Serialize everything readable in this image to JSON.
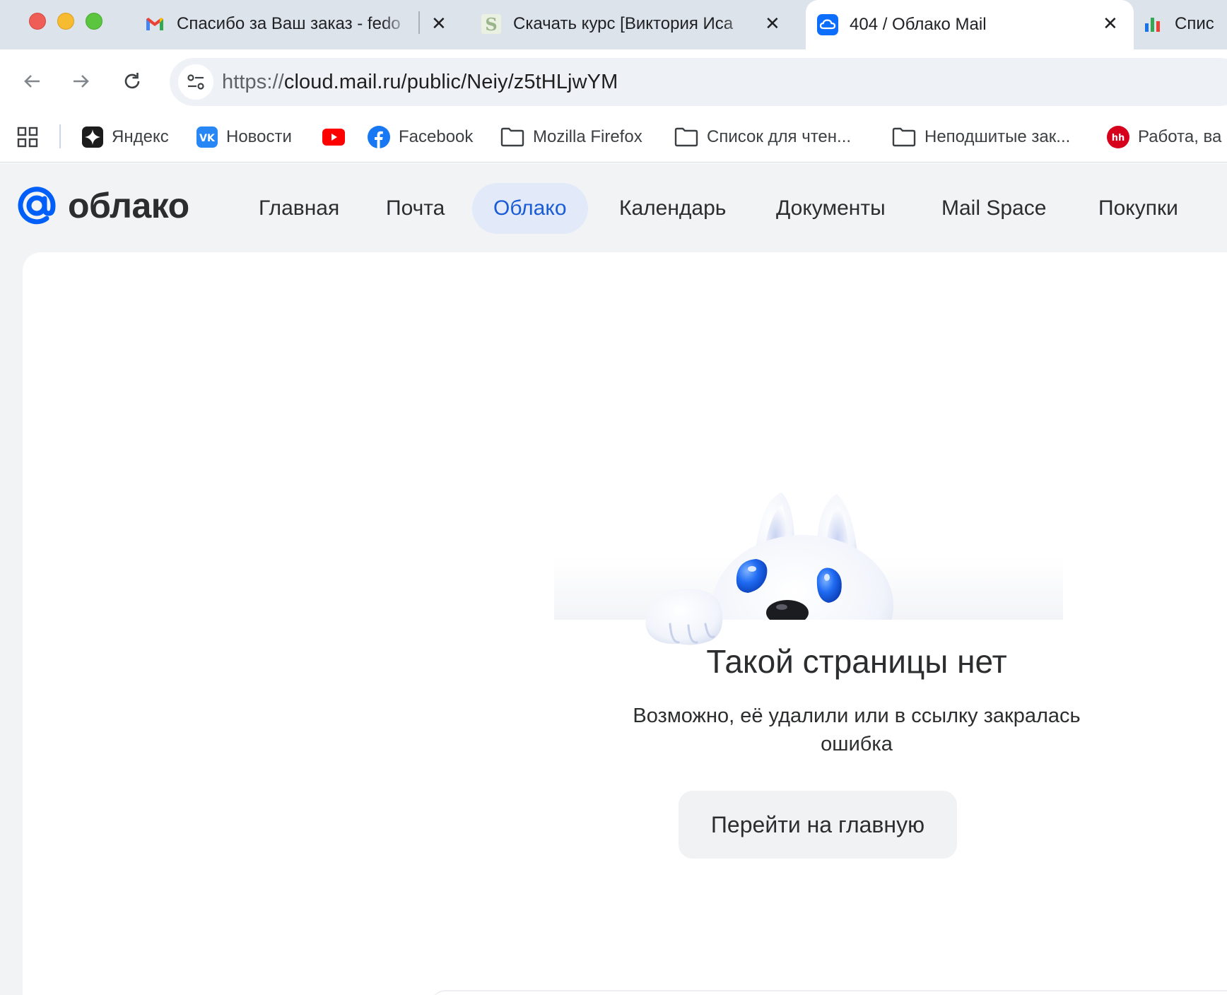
{
  "browser": {
    "tabs": [
      {
        "title": "Спасибо за Ваш заказ - fedo",
        "icon": "gmail-icon"
      },
      {
        "title": "Скачать курс [Виктория Иса",
        "icon": "s-logo-icon"
      },
      {
        "title": "404 / Облако Mail",
        "icon": "cloud-icon",
        "active": true
      },
      {
        "title": "Спис",
        "icon": "chart-bars-icon"
      }
    ],
    "close_glyph": "✕",
    "url": {
      "scheme": "https://",
      "rest": "cloud.mail.ru/public/Neiy/z5tHLjwYM"
    },
    "bookmarks": [
      {
        "label": "Яндекс",
        "icon": "yandex-icon"
      },
      {
        "label": "Новости",
        "icon": "vk-icon"
      },
      {
        "label": "",
        "icon": "youtube-icon"
      },
      {
        "label": "Facebook",
        "icon": "facebook-icon"
      },
      {
        "label": "Mozilla Firefox",
        "icon": "folder-icon"
      },
      {
        "label": "Список для чтен...",
        "icon": "folder-icon"
      },
      {
        "label": "Неподшитые зак...",
        "icon": "folder-icon"
      },
      {
        "label": "Работа, ва",
        "icon": "hh-icon"
      }
    ],
    "hh_badge": "hh"
  },
  "site": {
    "logo_text": "облако",
    "nav": [
      {
        "label": "Главная"
      },
      {
        "label": "Почта"
      },
      {
        "label": "Облако",
        "active": true
      },
      {
        "label": "Календарь"
      },
      {
        "label": "Документы"
      },
      {
        "label": "Mail Space"
      },
      {
        "label": "Покупки"
      }
    ]
  },
  "error": {
    "title": "Такой страницы нет",
    "description": "Возможно, её удалили или в ссылку закралась ошибка",
    "button": "Перейти на главную"
  },
  "colors": {
    "accent": "#005ff9",
    "nav_active_bg": "#e2e9f8",
    "nav_active_text": "#1a5cd6",
    "tabstrip_bg": "#dde3ea",
    "page_bg": "#f2f3f5"
  }
}
